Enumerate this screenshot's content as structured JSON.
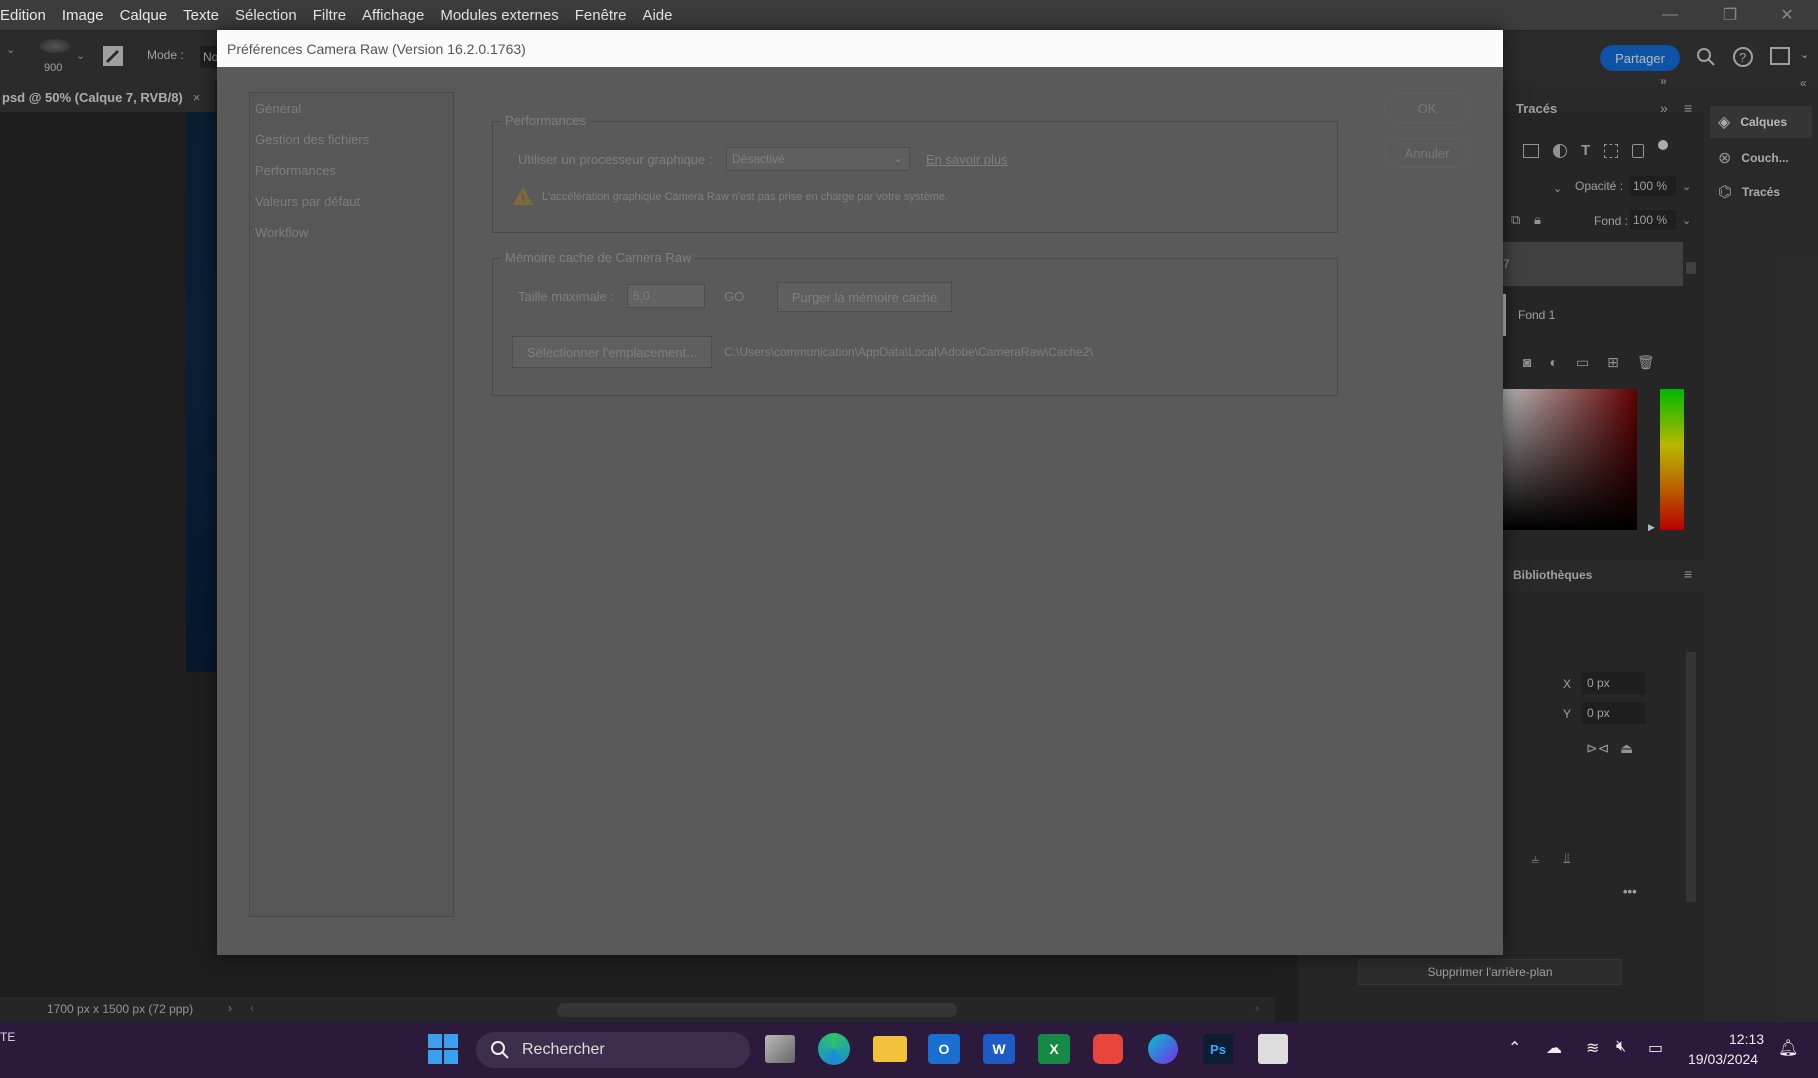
{
  "menu": [
    "Edition",
    "Image",
    "Calque",
    "Texte",
    "Sélection",
    "Filtre",
    "Affichage",
    "Modules externes",
    "Fenêtre",
    "Aide"
  ],
  "options_bar": {
    "brush_size": "900",
    "mode_label": "Mode :",
    "mode_value": "No",
    "share_label": "Partager"
  },
  "doc_tab": {
    "title": "psd @ 50% (Calque 7, RVB/8)",
    "close": "×"
  },
  "status": {
    "doc_size": "1700 px x 1500 px (72 ppp)"
  },
  "dialog": {
    "title": "Préférences Camera Raw  (Version 16.2.0.1763)",
    "nav": [
      "Général",
      "Gestion des fichiers",
      "Performances",
      "Valeurs par défaut",
      "Workflow"
    ],
    "perf": {
      "legend": "Performances",
      "gpu_label": "Utiliser un processeur graphique :",
      "gpu_value": "Désactivé",
      "learn_more": "En savoir plus",
      "warning": "L'accélération graphique Camera Raw n'est pas prise en charge par votre système."
    },
    "cache": {
      "legend": "Mémoire cache de Camera Raw",
      "max_label": "Taille maximale :",
      "max_value": "5,0",
      "unit": "GO",
      "purge": "Purger la mémoire cache",
      "select": "Sélectionner l'emplacement...",
      "path": "C:\\Users\\communication\\AppData\\Local\\Adobe\\CameraRaw\\Cache2\\"
    },
    "ok": "OK",
    "cancel": "Annuler"
  },
  "panels": {
    "paths_tab": "Tracés",
    "opacity_label": "Opacité :",
    "opacity_value": "100 %",
    "fill_label": "Fond :",
    "fill_value": "100 %",
    "layer_top": "7",
    "layer_name": "Fond 1",
    "libraries": "Bibliothèques",
    "x_label": "X",
    "x_value": "0 px",
    "y_label": "Y",
    "y_value": "0 px",
    "more": "•••",
    "remove_bg": "Supprimer l'arrière-plan"
  },
  "dock": {
    "layers": "Calques",
    "channels": "Couch...",
    "paths": "Tracés"
  },
  "taskbar": {
    "left_text": "TE",
    "search": "Rechercher",
    "time": "12:13",
    "date": "19/03/2024"
  },
  "colors": {
    "accent": "#1473e6",
    "dialog_bg": "#5a5a5a",
    "taskbar": "#2b1a3c"
  }
}
